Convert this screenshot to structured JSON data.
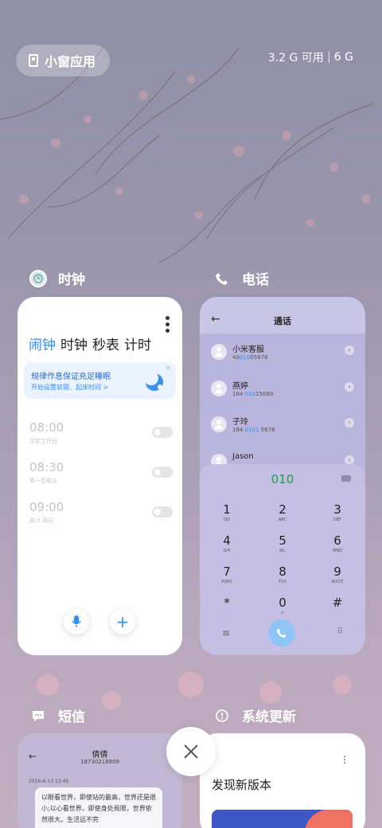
{
  "topbar": {
    "mini_window_label": "小窗应用",
    "memory_free": "3.2 G 可用",
    "memory_total": "6 G"
  },
  "cards": {
    "clock": {
      "app_name": "时钟",
      "tabs": [
        "闹钟",
        "时钟",
        "秒表",
        "计时"
      ],
      "banner_title": "规律作息保证充足睡眠",
      "banner_sub": "开始设置就寝、起床时间 >",
      "banner_close": "×",
      "alarms": [
        {
          "time": "08:00",
          "repeat": "法定工作日"
        },
        {
          "time": "08:30",
          "repeat": "周一至周五"
        },
        {
          "time": "09:00",
          "repeat": "周六 周日"
        }
      ]
    },
    "phone": {
      "app_name": "电话",
      "title": "通话",
      "contacts": [
        {
          "name": "小米客服",
          "num_pre": "40",
          "num_hl": "010",
          "num_post": "05678"
        },
        {
          "name": "燕婷",
          "num_pre": "184 ",
          "num_hl": "010",
          "num_post": "15689"
        },
        {
          "name": "子玲",
          "num_pre": "184 ",
          "num_hl": "0101",
          "num_post": " 5678"
        },
        {
          "name": "Jason",
          "num_pre": "",
          "num_hl": "",
          "num_post": ""
        }
      ],
      "dial_input": "010",
      "keys": [
        {
          "d": "1",
          "l": "QO"
        },
        {
          "d": "2",
          "l": "ABC"
        },
        {
          "d": "3",
          "l": "DEF"
        },
        {
          "d": "4",
          "l": "GHI"
        },
        {
          "d": "5",
          "l": "JKL"
        },
        {
          "d": "6",
          "l": "MNO"
        },
        {
          "d": "7",
          "l": "PQRS"
        },
        {
          "d": "8",
          "l": "TUV"
        },
        {
          "d": "9",
          "l": "WXYZ"
        },
        {
          "d": "*",
          "l": ","
        },
        {
          "d": "0",
          "l": "+"
        },
        {
          "d": "#",
          "l": ""
        }
      ]
    },
    "sms": {
      "app_name": "短信",
      "contact_name": "倩倩",
      "contact_number": "18730218809",
      "date": "2016-6-13 13:49",
      "message": "以眼看世界，即使站的最高，世界还是很小;以心看世界，即使身处局限，世界依然很大。生活远不完"
    },
    "update": {
      "app_name": "系统更新",
      "title": "发现新版本"
    }
  },
  "colors": {
    "accent": "#2f8ef7",
    "dial_green": "#1aa04a",
    "phone_bg": "#b9b5dc"
  }
}
